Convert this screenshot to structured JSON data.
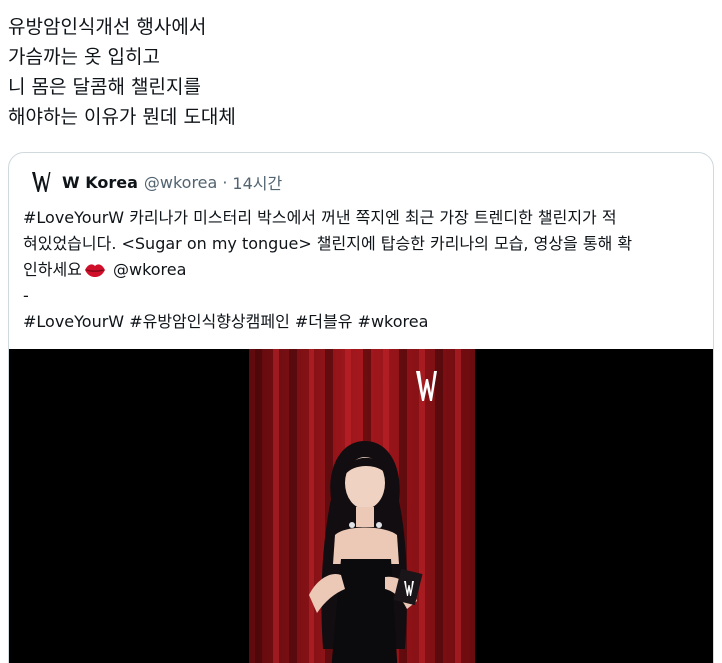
{
  "post": {
    "lines": [
      "유방암인식개선 행사에서",
      "가슴까는 옷 입히고",
      "니 몸은 달콤해 챌린지를",
      "해야하는 이유가 뭔데 도대체"
    ]
  },
  "quote": {
    "author_name": "W Korea",
    "handle": "@wkorea",
    "separator": "·",
    "time": "14시간",
    "avatar_icon": "w-logo-icon",
    "body": {
      "line1": "#LoveYourW 카리나가 미스터리 박스에서 꺼낸 쪽지엔 최근 가장 트렌디한 챌린지가 적",
      "line2": "혀있었습니다. <Sugar on my tongue> 챌린지에 탑승한 카리나의 모습, 영상을 통해 확",
      "line3_before": "인하세요",
      "line3_after": " @wkorea",
      "line3_icon": "lips-emoji-icon",
      "line4": "-",
      "line5": "#LoveYourW #유방암인식향상캠페인 #더블유 #wkorea"
    },
    "media": {
      "type": "video",
      "watermark": "W"
    }
  },
  "colors": {
    "text": "#0f1419",
    "secondary": "#536471",
    "border": "#cfd9de",
    "media_bg": "#000000",
    "curtain": "#8e1418"
  }
}
